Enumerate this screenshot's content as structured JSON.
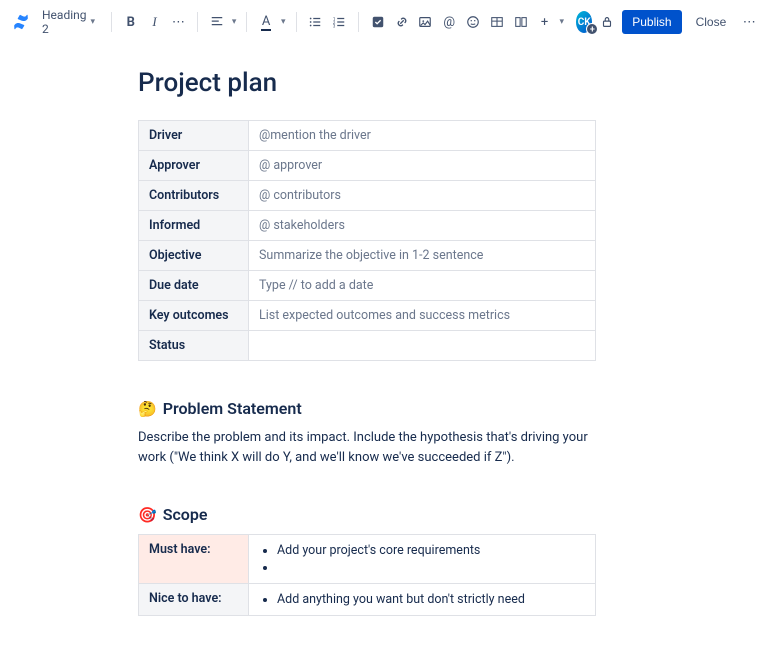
{
  "toolbar": {
    "text_style": "Heading 2",
    "publish": "Publish",
    "close": "Close",
    "avatar_initials": "CK"
  },
  "page": {
    "title": "Project plan"
  },
  "meta_table": [
    {
      "label": "Driver",
      "value": "@mention the driver",
      "placeholder": true
    },
    {
      "label": "Approver",
      "value": "@ approver",
      "placeholder": true
    },
    {
      "label": "Contributors",
      "value": "@ contributors",
      "placeholder": true
    },
    {
      "label": "Informed",
      "value": "@ stakeholders",
      "placeholder": true
    },
    {
      "label": "Objective",
      "value": "Summarize the objective in 1-2 sentence",
      "placeholder": true
    },
    {
      "label": "Due date",
      "value": "Type // to add a date",
      "placeholder": true
    },
    {
      "label": "Key outcomes",
      "value": "List expected outcomes and success metrics",
      "placeholder": true
    },
    {
      "label": "Status",
      "value": "",
      "placeholder": true
    }
  ],
  "problem": {
    "emoji": "🤔",
    "heading": "Problem Statement",
    "body": "Describe the problem and its impact. Include the hypothesis that's driving your work (\"We think X will do Y, and we'll know we've succeeded if Z\")."
  },
  "scope": {
    "emoji": "🎯",
    "heading": "Scope",
    "rows": [
      {
        "label": "Must have:",
        "items": [
          "Add your project's core requirements",
          ""
        ],
        "class": "must"
      },
      {
        "label": "Nice to have:",
        "items": [
          "Add anything you want but don't strictly need"
        ],
        "class": ""
      }
    ]
  }
}
